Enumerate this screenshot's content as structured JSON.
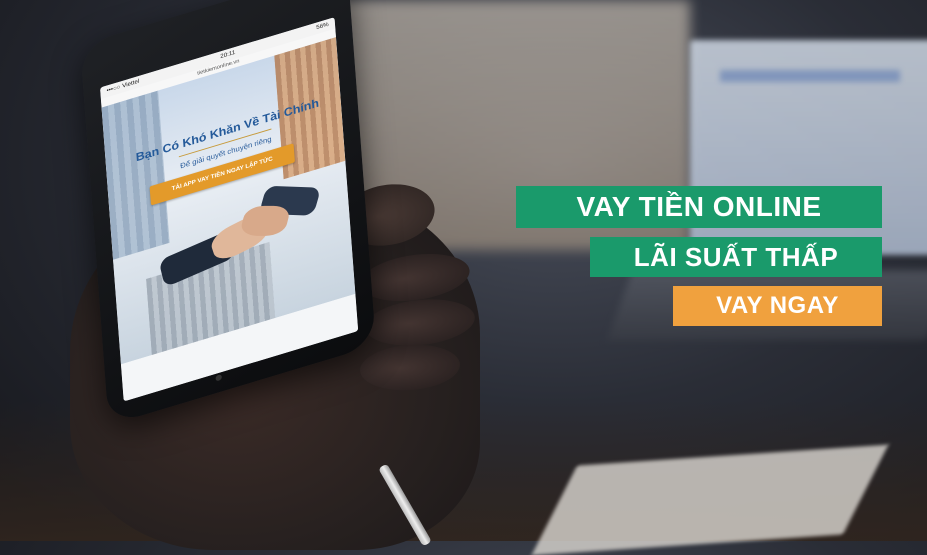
{
  "phone": {
    "status": {
      "carrier": "•••○○ Viettel",
      "time": "20:11",
      "battery": "56%"
    },
    "url": "tietkiemonline.vn",
    "hero_title": "Bạn Có Khó Khăn Về Tài Chính",
    "hero_subtitle": "Để giải quyết chuyện riêng",
    "cta_label": "TẢI APP VAY TIỀN NGAY LẬP TỨC"
  },
  "banners": {
    "line1": "VAY TIỀN ONLINE",
    "line2": "LÃI SUẤT THẤP",
    "line3": "VAY NGAY"
  },
  "colors": {
    "banner_green": "#1a9a6b",
    "banner_orange": "#f0a13e",
    "cta_orange": "#e39a2a"
  }
}
